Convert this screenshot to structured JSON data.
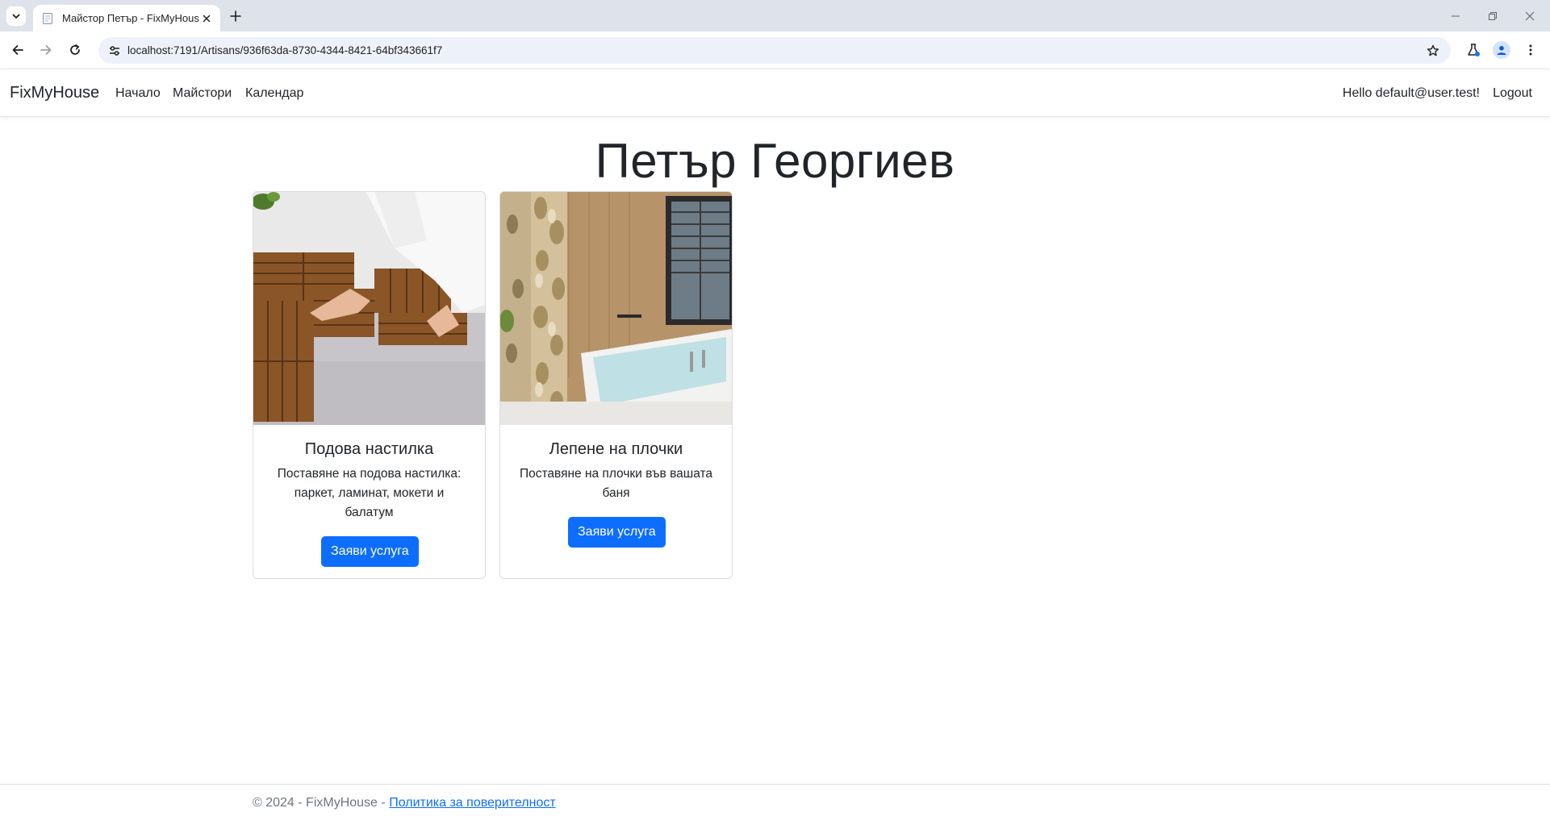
{
  "browser": {
    "tab_title": "Майстор Петър - FixMyHouse",
    "url": "localhost:7191/Artisans/936f63da-8730-4344-8421-64bf343661f7"
  },
  "nav": {
    "brand": "FixMyHouse",
    "links": [
      "Начало",
      "Майстори",
      "Календар"
    ],
    "greeting": "Hello default@user.test!",
    "logout": "Logout"
  },
  "page": {
    "title": "Петър Георгиев"
  },
  "services": [
    {
      "title": "Подова настилка",
      "description": "Поставяне на подова настилка: паркет, ламинат, мокети и балатум",
      "button": "Заяви услуга"
    },
    {
      "title": "Лепене на плочки",
      "description": "Поставяне на плочки във вашата баня",
      "button": "Заяви услуга"
    }
  ],
  "footer": {
    "copyright": "© 2024 - FixMyHouse -",
    "privacy_link": "Политика за поверителност"
  },
  "colors": {
    "primary": "#0d6efd",
    "tabstrip": "#dee3eb",
    "omnibox": "#edf2fa"
  }
}
